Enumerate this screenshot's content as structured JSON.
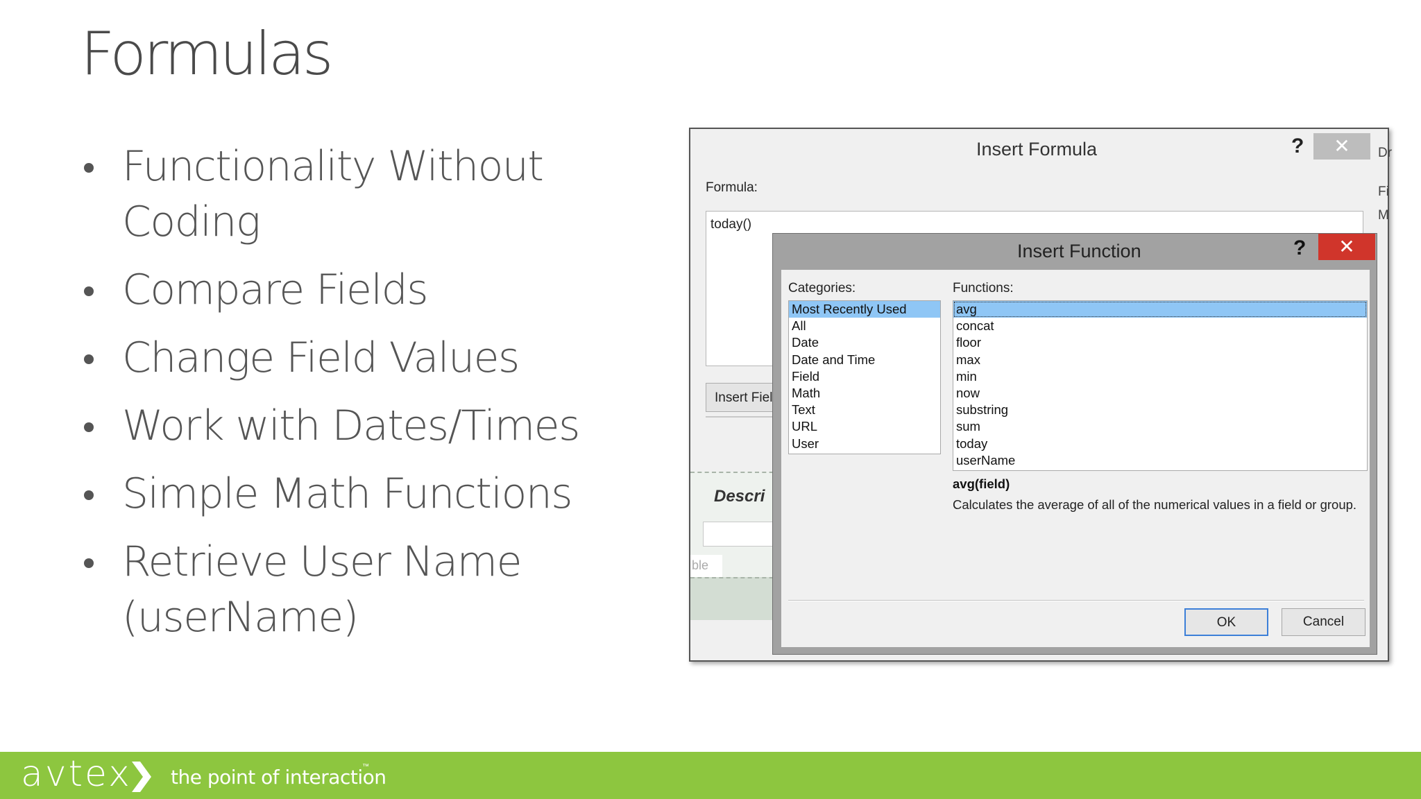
{
  "slide": {
    "title": "Formulas",
    "bullets": [
      "Functionality Without Coding",
      "Compare Fields",
      "Change Field Values",
      "Work with Dates/Times",
      "Simple Math Functions",
      "Retrieve User Name (userName)"
    ]
  },
  "footer": {
    "logo": "avtex",
    "tagline": "the point of interaction",
    "trademark": "™",
    "bg_color": "#8dc63f"
  },
  "formula_dialog": {
    "title": "Insert Formula",
    "help": "?",
    "close": "✕",
    "formula_label": "Formula:",
    "formula_value": "today()",
    "insert_field_label": "Insert Field",
    "background_fragment": "Descri",
    "background_fragment_2": "ble",
    "edge_fragments": [
      "Dr",
      "Fi",
      "M"
    ]
  },
  "function_dialog": {
    "title": "Insert Function",
    "help": "?",
    "close": "✕",
    "categories_label": "Categories:",
    "categories": [
      "Most Recently Used",
      "All",
      "Date",
      "Date and Time",
      "Field",
      "Math",
      "Text",
      "URL",
      "User"
    ],
    "selected_category": "Most Recently Used",
    "functions_label": "Functions:",
    "functions": [
      "avg",
      "concat",
      "floor",
      "max",
      "min",
      "now",
      "substring",
      "sum",
      "today",
      "userName"
    ],
    "selected_function": "avg",
    "signature": "avg(field)",
    "description": "Calculates the average of all of the numerical values in a field or group.",
    "ok_label": "OK",
    "cancel_label": "Cancel",
    "selection_color": "#8fc6f5",
    "close_color": "#d0352b"
  }
}
